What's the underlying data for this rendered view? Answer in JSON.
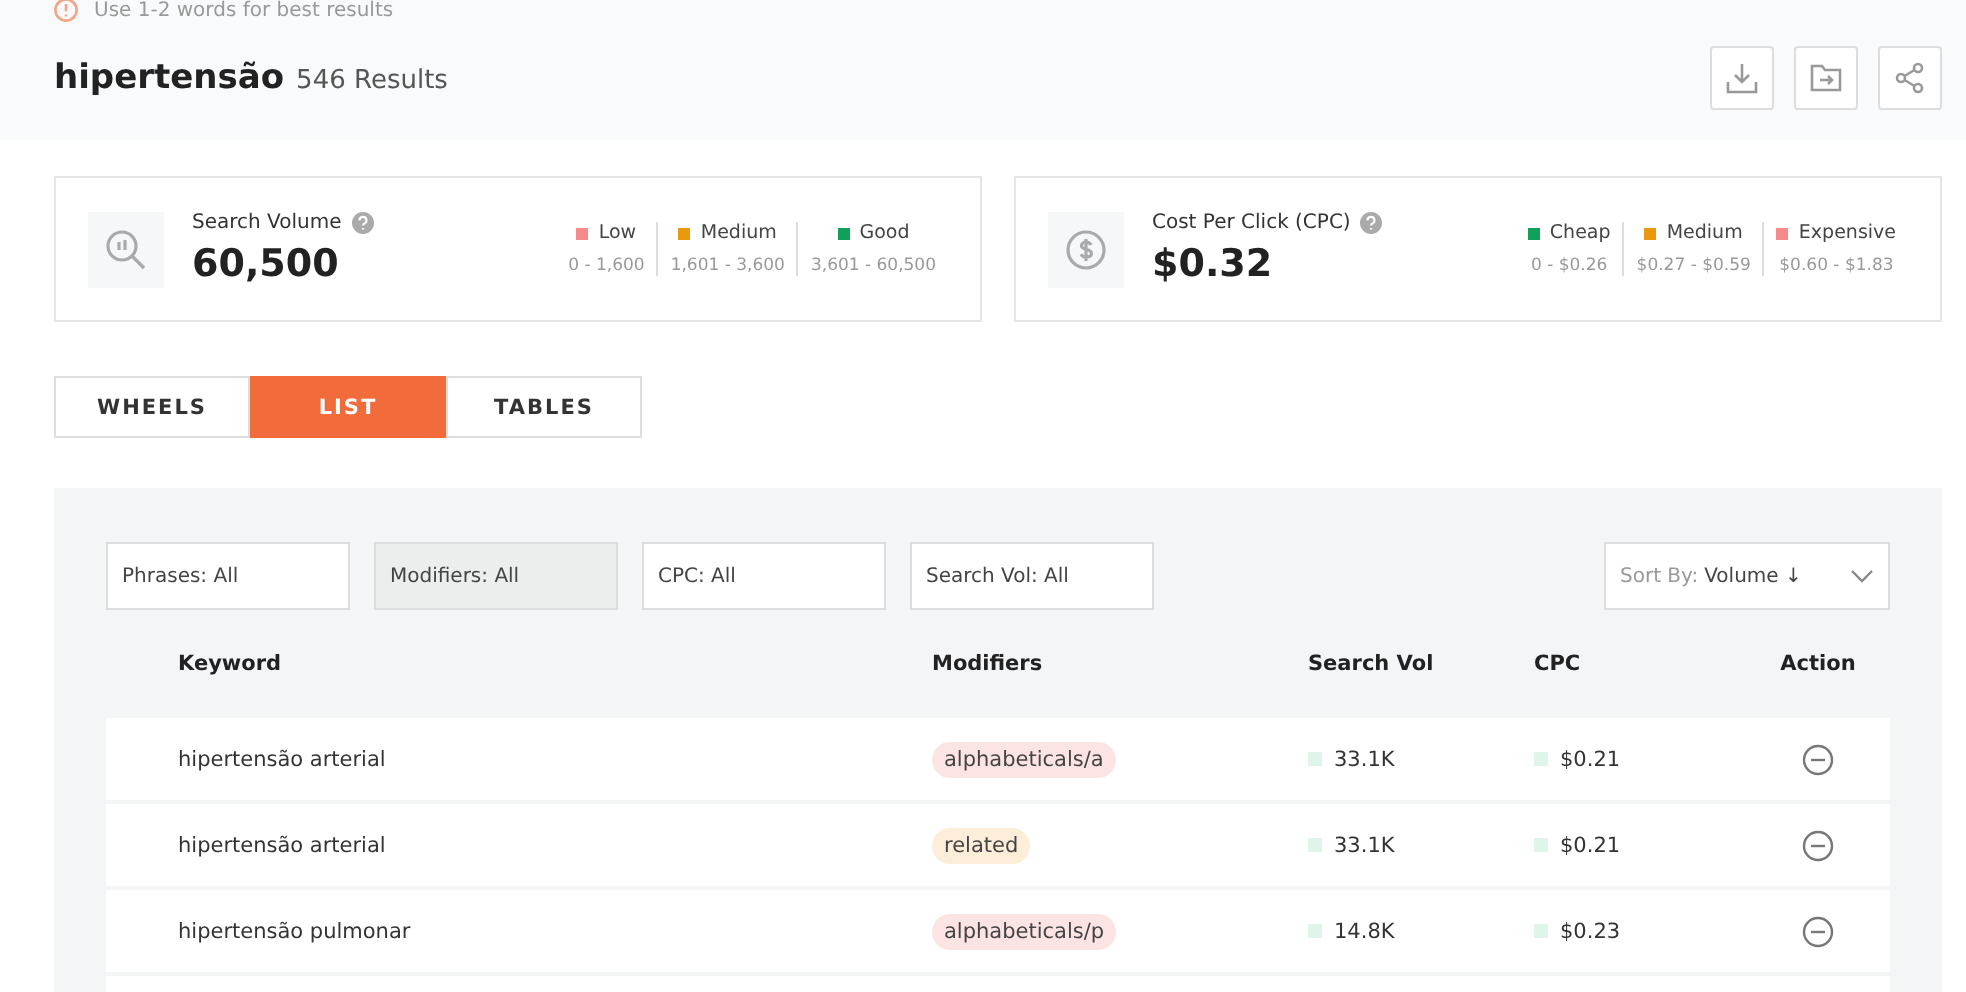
{
  "hint": "Use 1-2 words for best results",
  "header": {
    "keyword": "hipertensão",
    "results": "546 Results"
  },
  "summary_cards": [
    {
      "kind": "volume",
      "label": "Search Volume",
      "value": "60,500",
      "legend": [
        {
          "name": "Low",
          "range": "0 - 1,600",
          "color": "#f48a8a"
        },
        {
          "name": "Medium",
          "range": "1,601 - 3,600",
          "color": "#e99a0c"
        },
        {
          "name": "Good",
          "range": "3,601 - 60,500",
          "color": "#11a05a"
        }
      ]
    },
    {
      "kind": "cpc",
      "label": "Cost Per Click (CPC)",
      "value": "$0.32",
      "legend": [
        {
          "name": "Cheap",
          "range": "0 - $0.26",
          "color": "#11a05a"
        },
        {
          "name": "Medium",
          "range": "$0.27 - $0.59",
          "color": "#e99a0c"
        },
        {
          "name": "Expensive",
          "range": "$0.60 - $1.83",
          "color": "#f48a8a"
        }
      ]
    }
  ],
  "tabs": [
    {
      "label": "WHEELS",
      "selected": false
    },
    {
      "label": "LIST",
      "selected": true
    },
    {
      "label": "TABLES",
      "selected": false
    }
  ],
  "filters": [
    {
      "label": "Phrases: All",
      "active": false
    },
    {
      "label": "Modifiers: All",
      "active": true
    },
    {
      "label": "CPC: All",
      "active": false
    },
    {
      "label": "Search Vol: All",
      "active": false
    }
  ],
  "sort": {
    "prefix": "Sort By:",
    "value": "Volume ↓"
  },
  "table": {
    "columns": [
      "Keyword",
      "Modifiers",
      "Search Vol",
      "CPC",
      "Action"
    ],
    "rows": [
      {
        "keyword": "hipertensão arterial",
        "modifier": "alphabeticals/a",
        "color": "#fde4e4",
        "search_vol": "33.1K",
        "cpc": "$0.21"
      },
      {
        "keyword": "hipertensão arterial",
        "modifier": "related",
        "color": "#fdeed9",
        "search_vol": "33.1K",
        "cpc": "$0.21"
      },
      {
        "keyword": "hipertensão pulmonar",
        "modifier": "alphabeticals/p",
        "color": "#fde4e4",
        "search_vol": "14.8K",
        "cpc": "$0.23"
      }
    ]
  }
}
